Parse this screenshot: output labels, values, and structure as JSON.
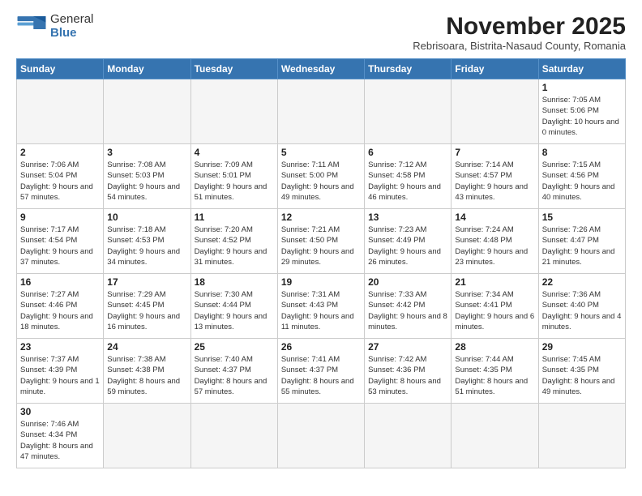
{
  "header": {
    "logo_general": "General",
    "logo_blue": "Blue",
    "month_title": "November 2025",
    "subtitle": "Rebrisoara, Bistrita-Nasaud County, Romania"
  },
  "weekdays": [
    "Sunday",
    "Monday",
    "Tuesday",
    "Wednesday",
    "Thursday",
    "Friday",
    "Saturday"
  ],
  "weeks": [
    [
      {
        "day": "",
        "info": ""
      },
      {
        "day": "",
        "info": ""
      },
      {
        "day": "",
        "info": ""
      },
      {
        "day": "",
        "info": ""
      },
      {
        "day": "",
        "info": ""
      },
      {
        "day": "",
        "info": ""
      },
      {
        "day": "1",
        "info": "Sunrise: 7:05 AM\nSunset: 5:06 PM\nDaylight: 10 hours and 0 minutes."
      }
    ],
    [
      {
        "day": "2",
        "info": "Sunrise: 7:06 AM\nSunset: 5:04 PM\nDaylight: 9 hours and 57 minutes."
      },
      {
        "day": "3",
        "info": "Sunrise: 7:08 AM\nSunset: 5:03 PM\nDaylight: 9 hours and 54 minutes."
      },
      {
        "day": "4",
        "info": "Sunrise: 7:09 AM\nSunset: 5:01 PM\nDaylight: 9 hours and 51 minutes."
      },
      {
        "day": "5",
        "info": "Sunrise: 7:11 AM\nSunset: 5:00 PM\nDaylight: 9 hours and 49 minutes."
      },
      {
        "day": "6",
        "info": "Sunrise: 7:12 AM\nSunset: 4:58 PM\nDaylight: 9 hours and 46 minutes."
      },
      {
        "day": "7",
        "info": "Sunrise: 7:14 AM\nSunset: 4:57 PM\nDaylight: 9 hours and 43 minutes."
      },
      {
        "day": "8",
        "info": "Sunrise: 7:15 AM\nSunset: 4:56 PM\nDaylight: 9 hours and 40 minutes."
      }
    ],
    [
      {
        "day": "9",
        "info": "Sunrise: 7:17 AM\nSunset: 4:54 PM\nDaylight: 9 hours and 37 minutes."
      },
      {
        "day": "10",
        "info": "Sunrise: 7:18 AM\nSunset: 4:53 PM\nDaylight: 9 hours and 34 minutes."
      },
      {
        "day": "11",
        "info": "Sunrise: 7:20 AM\nSunset: 4:52 PM\nDaylight: 9 hours and 31 minutes."
      },
      {
        "day": "12",
        "info": "Sunrise: 7:21 AM\nSunset: 4:50 PM\nDaylight: 9 hours and 29 minutes."
      },
      {
        "day": "13",
        "info": "Sunrise: 7:23 AM\nSunset: 4:49 PM\nDaylight: 9 hours and 26 minutes."
      },
      {
        "day": "14",
        "info": "Sunrise: 7:24 AM\nSunset: 4:48 PM\nDaylight: 9 hours and 23 minutes."
      },
      {
        "day": "15",
        "info": "Sunrise: 7:26 AM\nSunset: 4:47 PM\nDaylight: 9 hours and 21 minutes."
      }
    ],
    [
      {
        "day": "16",
        "info": "Sunrise: 7:27 AM\nSunset: 4:46 PM\nDaylight: 9 hours and 18 minutes."
      },
      {
        "day": "17",
        "info": "Sunrise: 7:29 AM\nSunset: 4:45 PM\nDaylight: 9 hours and 16 minutes."
      },
      {
        "day": "18",
        "info": "Sunrise: 7:30 AM\nSunset: 4:44 PM\nDaylight: 9 hours and 13 minutes."
      },
      {
        "day": "19",
        "info": "Sunrise: 7:31 AM\nSunset: 4:43 PM\nDaylight: 9 hours and 11 minutes."
      },
      {
        "day": "20",
        "info": "Sunrise: 7:33 AM\nSunset: 4:42 PM\nDaylight: 9 hours and 8 minutes."
      },
      {
        "day": "21",
        "info": "Sunrise: 7:34 AM\nSunset: 4:41 PM\nDaylight: 9 hours and 6 minutes."
      },
      {
        "day": "22",
        "info": "Sunrise: 7:36 AM\nSunset: 4:40 PM\nDaylight: 9 hours and 4 minutes."
      }
    ],
    [
      {
        "day": "23",
        "info": "Sunrise: 7:37 AM\nSunset: 4:39 PM\nDaylight: 9 hours and 1 minute."
      },
      {
        "day": "24",
        "info": "Sunrise: 7:38 AM\nSunset: 4:38 PM\nDaylight: 8 hours and 59 minutes."
      },
      {
        "day": "25",
        "info": "Sunrise: 7:40 AM\nSunset: 4:37 PM\nDaylight: 8 hours and 57 minutes."
      },
      {
        "day": "26",
        "info": "Sunrise: 7:41 AM\nSunset: 4:37 PM\nDaylight: 8 hours and 55 minutes."
      },
      {
        "day": "27",
        "info": "Sunrise: 7:42 AM\nSunset: 4:36 PM\nDaylight: 8 hours and 53 minutes."
      },
      {
        "day": "28",
        "info": "Sunrise: 7:44 AM\nSunset: 4:35 PM\nDaylight: 8 hours and 51 minutes."
      },
      {
        "day": "29",
        "info": "Sunrise: 7:45 AM\nSunset: 4:35 PM\nDaylight: 8 hours and 49 minutes."
      }
    ],
    [
      {
        "day": "30",
        "info": "Sunrise: 7:46 AM\nSunset: 4:34 PM\nDaylight: 8 hours and 47 minutes."
      },
      {
        "day": "",
        "info": ""
      },
      {
        "day": "",
        "info": ""
      },
      {
        "day": "",
        "info": ""
      },
      {
        "day": "",
        "info": ""
      },
      {
        "day": "",
        "info": ""
      },
      {
        "day": "",
        "info": ""
      }
    ]
  ]
}
